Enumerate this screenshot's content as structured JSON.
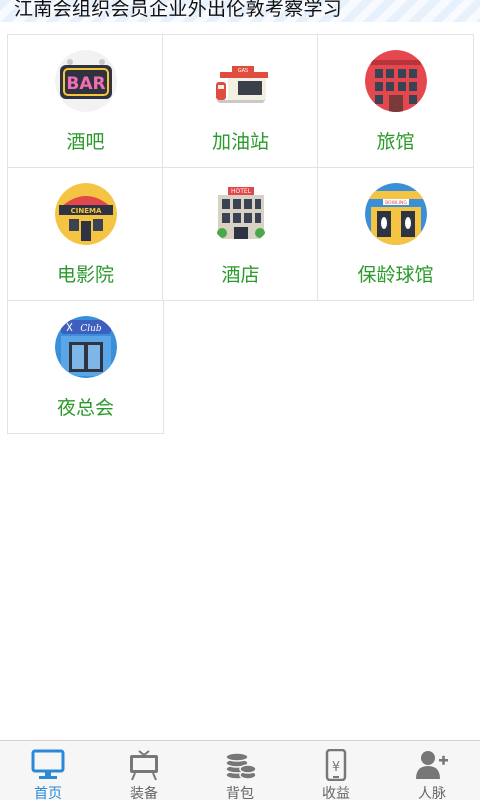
{
  "header": {
    "title": "江南会组织会员企业外出伦敦考察学习"
  },
  "places": [
    {
      "label": "酒吧",
      "icon": "bar-sign-icon",
      "sign": "BAR"
    },
    {
      "label": "加油站",
      "icon": "gas-station-icon",
      "sign": "GAS"
    },
    {
      "label": "旅馆",
      "icon": "hostel-building-icon"
    },
    {
      "label": "电影院",
      "icon": "cinema-building-icon",
      "sign": "CINEMA"
    },
    {
      "label": "酒店",
      "icon": "hotel-building-icon",
      "sign": "HOTEL"
    },
    {
      "label": "保龄球馆",
      "icon": "bowling-alley-icon",
      "sign": "BOWLING"
    },
    {
      "label": "夜总会",
      "icon": "nightclub-icon",
      "sign": "Club"
    }
  ],
  "tabbar": {
    "items": [
      {
        "label": "首页",
        "icon": "monitor-icon",
        "active": true
      },
      {
        "label": "装备",
        "icon": "tv-easel-icon",
        "active": false
      },
      {
        "label": "背包",
        "icon": "coins-stack-icon",
        "active": false
      },
      {
        "label": "收益",
        "icon": "phone-yuan-icon",
        "active": false
      },
      {
        "label": "人脉",
        "icon": "add-person-icon",
        "active": false
      }
    ]
  },
  "colors": {
    "accent": "#2a8ad8",
    "label_green": "#2b9a2b"
  }
}
